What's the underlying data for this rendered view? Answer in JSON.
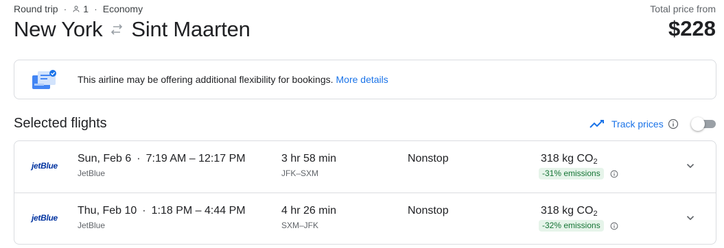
{
  "header": {
    "trip_type": "Round trip",
    "passengers": "1",
    "cabin": "Economy",
    "origin": "New York",
    "destination": "Sint Maarten",
    "price_label": "Total price from",
    "price": "$228"
  },
  "banner": {
    "message": "This airline may be offering additional flexibility for bookings.",
    "link": "More details"
  },
  "section": {
    "title": "Selected flights",
    "track_label": "Track prices"
  },
  "flights": [
    {
      "logo": "jetBlue",
      "date": "Sun, Feb 6",
      "times": "7:19 AM – 12:17 PM",
      "airline": "JetBlue",
      "duration": "3 hr 58 min",
      "airports": "JFK–SXM",
      "stops": "Nonstop",
      "co2": "318 kg CO",
      "co2_sub": "2",
      "emissions": "-31% emissions"
    },
    {
      "logo": "jetBlue",
      "date": "Thu, Feb 10",
      "times": "1:18 PM – 4:44 PM",
      "airline": "JetBlue",
      "duration": "4 hr 26 min",
      "airports": "SXM–JFK",
      "stops": "Nonstop",
      "co2": "318 kg CO",
      "co2_sub": "2",
      "emissions": "-32% emissions"
    }
  ],
  "colors": {
    "accent": "#1a73e8",
    "emission_badge_bg": "#e6f4ea",
    "emission_badge_text": "#137333",
    "jetblue": "#0033a0"
  },
  "icons": {
    "person": "person-icon",
    "swap": "swap-arrows-icon",
    "banner": "flexible-booking-illustration",
    "trend": "trending-line-icon",
    "info": "info-icon",
    "expand": "chevron-down-icon"
  }
}
